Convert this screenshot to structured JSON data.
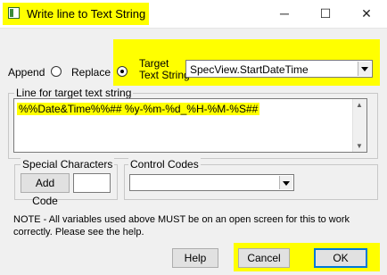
{
  "window": {
    "title": "Write line to Text String",
    "minimize_glyph": "─",
    "maximize_glyph": "☐",
    "close_glyph": "✕"
  },
  "mode": {
    "append_label": "Append",
    "replace_label": "Replace",
    "selected": "replace"
  },
  "target": {
    "label_line1": "Target",
    "label_line2": "Text String",
    "value": "SpecView.StartDateTime"
  },
  "line_group": {
    "label": "Line for target text string",
    "value": "%%Date&Time%%## %y-%m-%d_%H-%M-%S##"
  },
  "special_chars": {
    "label": "Special Characters",
    "add_code_label": "Add Code",
    "code_value": ""
  },
  "control_codes": {
    "label": "Control Codes",
    "value": ""
  },
  "note": "NOTE - All variables used above MUST be on an open screen for this to work correctly. Please see the help.",
  "buttons": {
    "help": "Help",
    "cancel": "Cancel",
    "ok": "OK"
  },
  "highlight_color": "#ffff00",
  "accent_color": "#0078d7"
}
